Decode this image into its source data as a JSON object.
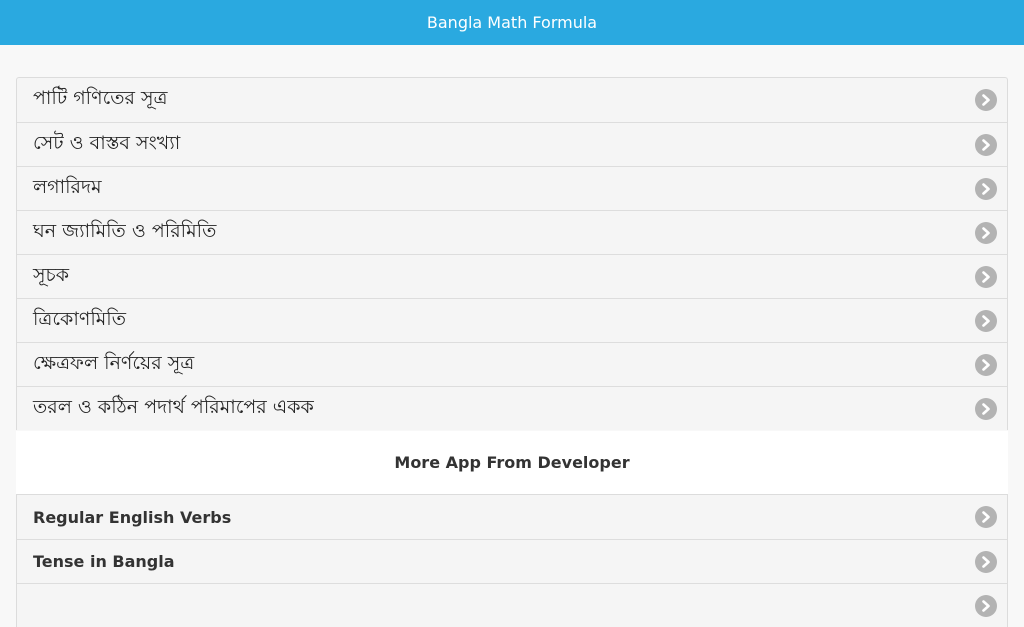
{
  "header": {
    "title": "Bangla Math Formula"
  },
  "formula_list": {
    "items": [
      {
        "label": "পাটি গণিতের সূত্র"
      },
      {
        "label": "সেট ও বাস্তব সংখ্যা"
      },
      {
        "label": "লগারিদম"
      },
      {
        "label": "ঘন জ্যামিতি ও পরিমিতি"
      },
      {
        "label": "সূচক"
      },
      {
        "label": "ত্রিকোণমিতি"
      },
      {
        "label": "ক্ষেত্রফল নির্ণয়ের সূত্র"
      },
      {
        "label": "তরল ও কঠিন পদার্থ পরিমাপের একক"
      }
    ]
  },
  "more_apps": {
    "heading": "More App From Developer",
    "items": [
      {
        "label": "Regular English Verbs"
      },
      {
        "label": "Tense in Bangla"
      },
      {
        "label": ""
      }
    ]
  },
  "icons": {
    "row_arrow": "chevron-right-circle-icon"
  },
  "colors": {
    "header_bg": "#2aa9e0",
    "chevron_bg": "#b3b3b3"
  }
}
